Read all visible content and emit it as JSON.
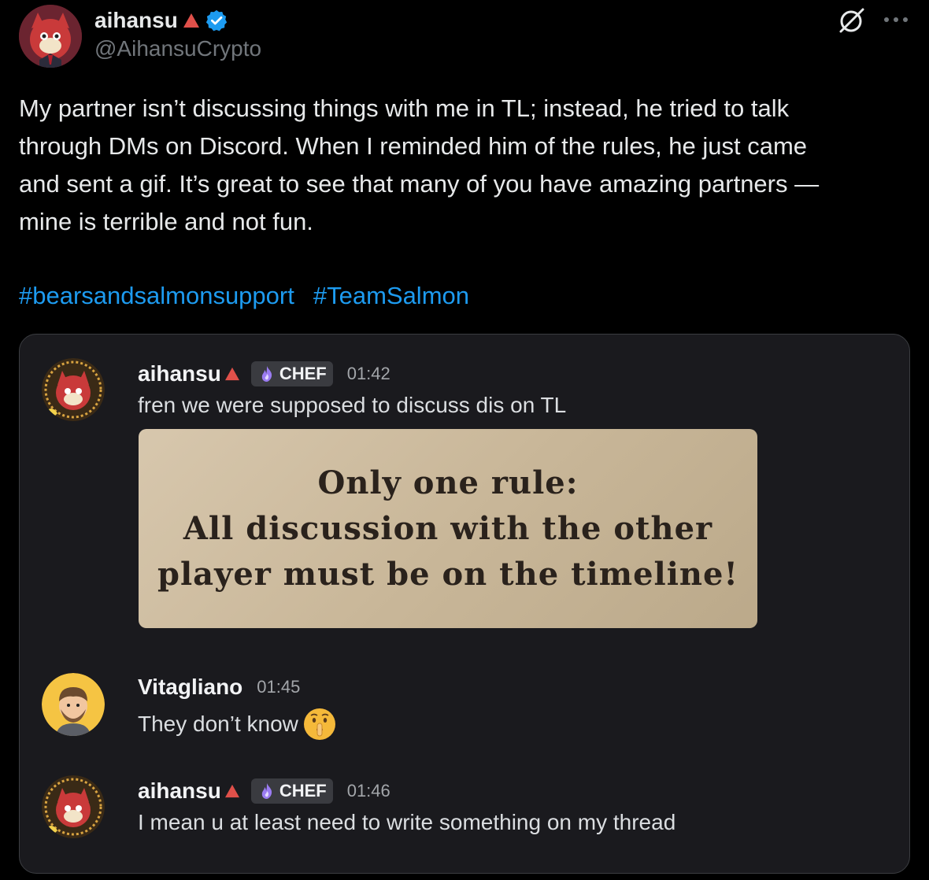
{
  "post": {
    "author": {
      "display_name": "aihansu",
      "handle": "@AihansuCrypto",
      "verified": true
    },
    "text": "My partner isn’t discussing things with me in TL; instead, he tried to talk\nthrough DMs on Discord. When I reminded him of the rules, he just came\nand sent a gif. It’s great to see that many of you have amazing partners —\nmine is terrible and not fun.",
    "hashtags": [
      "#bearsandsalmonsupport",
      "#TeamSalmon"
    ],
    "icons": {
      "grok": "grok-icon",
      "more": "more-icon",
      "verified": "verified-badge-icon",
      "triangle": "red-triangle-icon"
    },
    "colors": {
      "accent": "#1d9bf0",
      "background": "#000000",
      "muted": "#71767b"
    }
  },
  "media": {
    "messages": [
      {
        "user": "aihansu",
        "role": "CHEF",
        "time": "01:42",
        "text": "fren we were supposed to discuss dis on TL",
        "image_text": [
          "Only one rule:",
          "All discussion with the other",
          "player must be on the timeline!"
        ]
      },
      {
        "user": "Vitagliano",
        "time": "01:45",
        "text": "They don’t know",
        "emoji": "shushing-face-icon"
      },
      {
        "user": "aihansu",
        "role": "CHEF",
        "time": "01:46",
        "text": "I mean u at least need to write something on my thread"
      }
    ]
  }
}
